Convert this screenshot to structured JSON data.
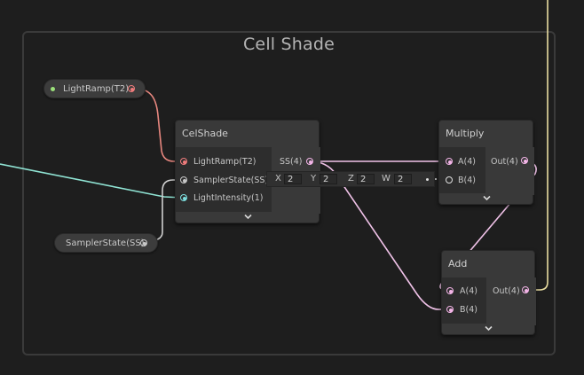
{
  "group": {
    "title": "Cell Shade"
  },
  "properties": {
    "light_ramp": "LightRamp(T2)",
    "sampler_state": "SamplerState(SS)"
  },
  "celshade": {
    "title": "CelShade",
    "inputs": [
      "LightRamp(T2)",
      "SamplerState(SS)",
      "LightIntensity(1)"
    ],
    "output": "SS(4)",
    "vector": {
      "x_label": "X",
      "x": "2",
      "y_label": "Y",
      "y": "2",
      "z_label": "Z",
      "z": "2",
      "w_label": "W",
      "w": "2"
    }
  },
  "multiply": {
    "title": "Multiply",
    "in_a": "A(4)",
    "in_b": "B(4)",
    "out": "Out(4)"
  },
  "add": {
    "title": "Add",
    "in_a": "A(4)",
    "in_b": "B(4)",
    "out": "Out(4)"
  },
  "colors": {
    "background": "#1e1e1e",
    "texture_port": "#f07c7c",
    "sampler_port": "#c8c8c8",
    "float_port": "#7ee0e0",
    "vector4_port": "#f4b5e8",
    "wire_texture": "#e8877f",
    "wire_float": "#8fe3d3",
    "wire_vector4": "#f0c2e8",
    "wire_yellow": "#e8dca0"
  }
}
